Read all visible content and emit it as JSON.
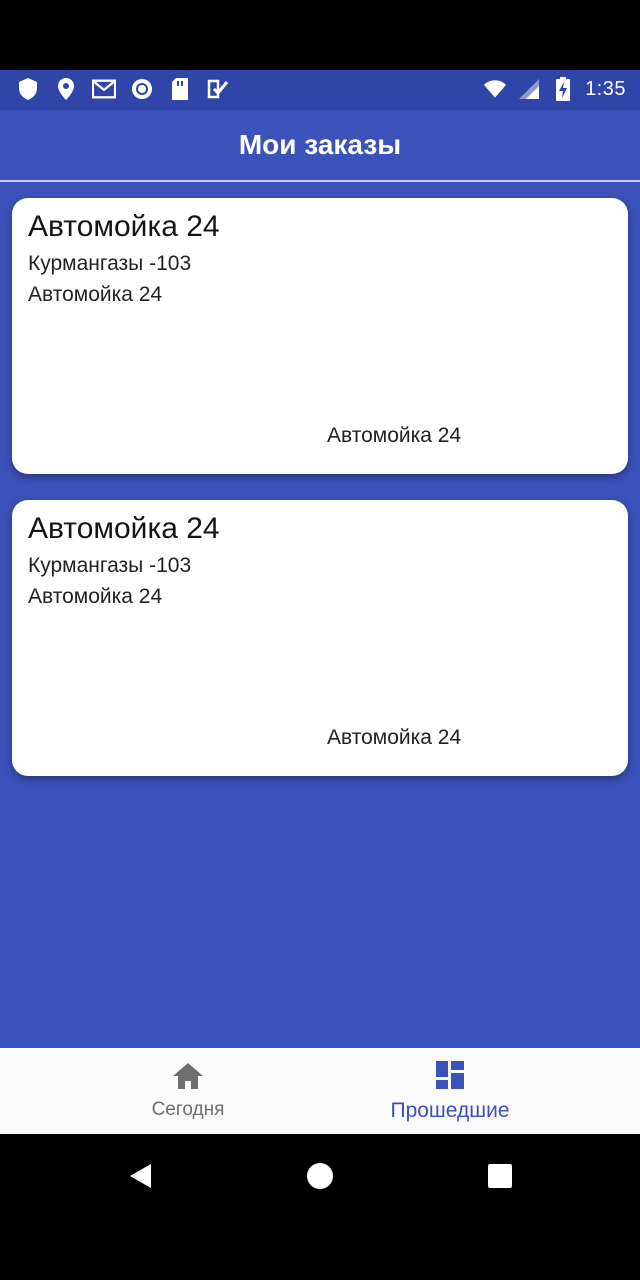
{
  "status_bar": {
    "time": "1:35",
    "left_icons": [
      "shield-icon",
      "location-icon",
      "gmail-icon",
      "circle-app-icon",
      "sd-card-icon",
      "task-check-icon"
    ],
    "right_icons": [
      "wifi-icon",
      "signal-icon",
      "battery-charging-icon"
    ]
  },
  "app_bar": {
    "title": "Мои заказы"
  },
  "orders": [
    {
      "title": "Автомойка 24",
      "address": "Курмангазы -103",
      "subtitle": "Автомойка 24",
      "footer": "Автомойка 24"
    },
    {
      "title": "Автомойка 24",
      "address": "Курмангазы -103",
      "subtitle": "Автомойка 24",
      "footer": "Автомойка 24"
    }
  ],
  "bottom_nav": {
    "items": [
      {
        "label": "Сегодня",
        "icon": "home-icon",
        "active": false
      },
      {
        "label": "Прошедшие",
        "icon": "dashboard-icon",
        "active": true
      }
    ]
  },
  "system_nav": {
    "buttons": [
      "back-icon",
      "home-circle-icon",
      "recents-icon"
    ]
  },
  "colors": {
    "primary": "#3a52b9",
    "status_bar": "#2f46a8",
    "active_nav": "#3a52b9",
    "inactive_nav": "#6f6f6f",
    "card_background": "#ffffff"
  }
}
